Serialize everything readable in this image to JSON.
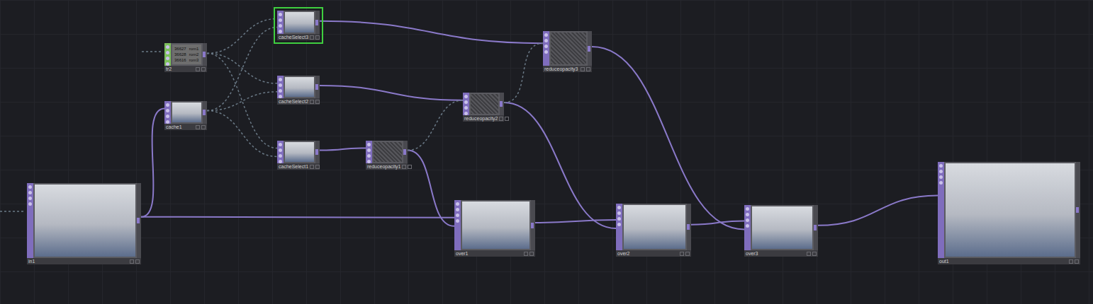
{
  "nodes": [
    {
      "label": "in1",
      "kind": "top-image",
      "selected": false
    },
    {
      "label": "tr2",
      "kind": "dat",
      "selected": false,
      "cells": [
        [
          "36627",
          "rom1"
        ],
        [
          "36628",
          "rom2"
        ],
        [
          "36616",
          "rom3"
        ]
      ]
    },
    {
      "label": "cache1",
      "kind": "top-image",
      "selected": false
    },
    {
      "label": "cacheSelect3",
      "kind": "top-image",
      "selected": true
    },
    {
      "label": "cacheSelect2",
      "kind": "top-image",
      "selected": false
    },
    {
      "label": "cacheSelect1",
      "kind": "top-image",
      "selected": false
    },
    {
      "label": "reduceopacity1",
      "kind": "top-faded",
      "selected": false
    },
    {
      "label": "reduceopacity2",
      "kind": "top-faded",
      "selected": false
    },
    {
      "label": "reduceopacity3",
      "kind": "top-faded",
      "selected": false
    },
    {
      "label": "over1",
      "kind": "top-image",
      "selected": false
    },
    {
      "label": "over2",
      "kind": "top-image",
      "selected": false
    },
    {
      "label": "over3",
      "kind": "top-image",
      "selected": false
    },
    {
      "label": "out1",
      "kind": "top-image",
      "selected": false
    }
  ],
  "wires": [
    {
      "from": 0,
      "to": 2,
      "kind": "link"
    },
    {
      "from": 0,
      "to": 9,
      "kind": "link"
    },
    {
      "from": 3,
      "to": 8,
      "kind": "link"
    },
    {
      "from": 4,
      "to": 7,
      "kind": "link"
    },
    {
      "from": 5,
      "to": 6,
      "kind": "link"
    },
    {
      "from": 6,
      "to": 9,
      "kind": "link"
    },
    {
      "from": 9,
      "to": 10,
      "kind": "link"
    },
    {
      "from": 7,
      "to": 10,
      "kind": "link"
    },
    {
      "from": 10,
      "to": 11,
      "kind": "link"
    },
    {
      "from": 8,
      "to": 11,
      "kind": "link"
    },
    {
      "from": 11,
      "to": 12,
      "kind": "link"
    },
    {
      "from": 1,
      "to": 3,
      "kind": "reference"
    },
    {
      "from": 1,
      "to": 4,
      "kind": "reference"
    },
    {
      "from": 1,
      "to": 5,
      "kind": "reference"
    },
    {
      "from": 2,
      "to": 3,
      "kind": "reference"
    },
    {
      "from": 2,
      "to": 4,
      "kind": "reference"
    },
    {
      "from": 2,
      "to": 5,
      "kind": "reference"
    },
    {
      "from": 6,
      "to": 7,
      "kind": "reference"
    },
    {
      "from": 7,
      "to": 8,
      "kind": "reference"
    }
  ]
}
